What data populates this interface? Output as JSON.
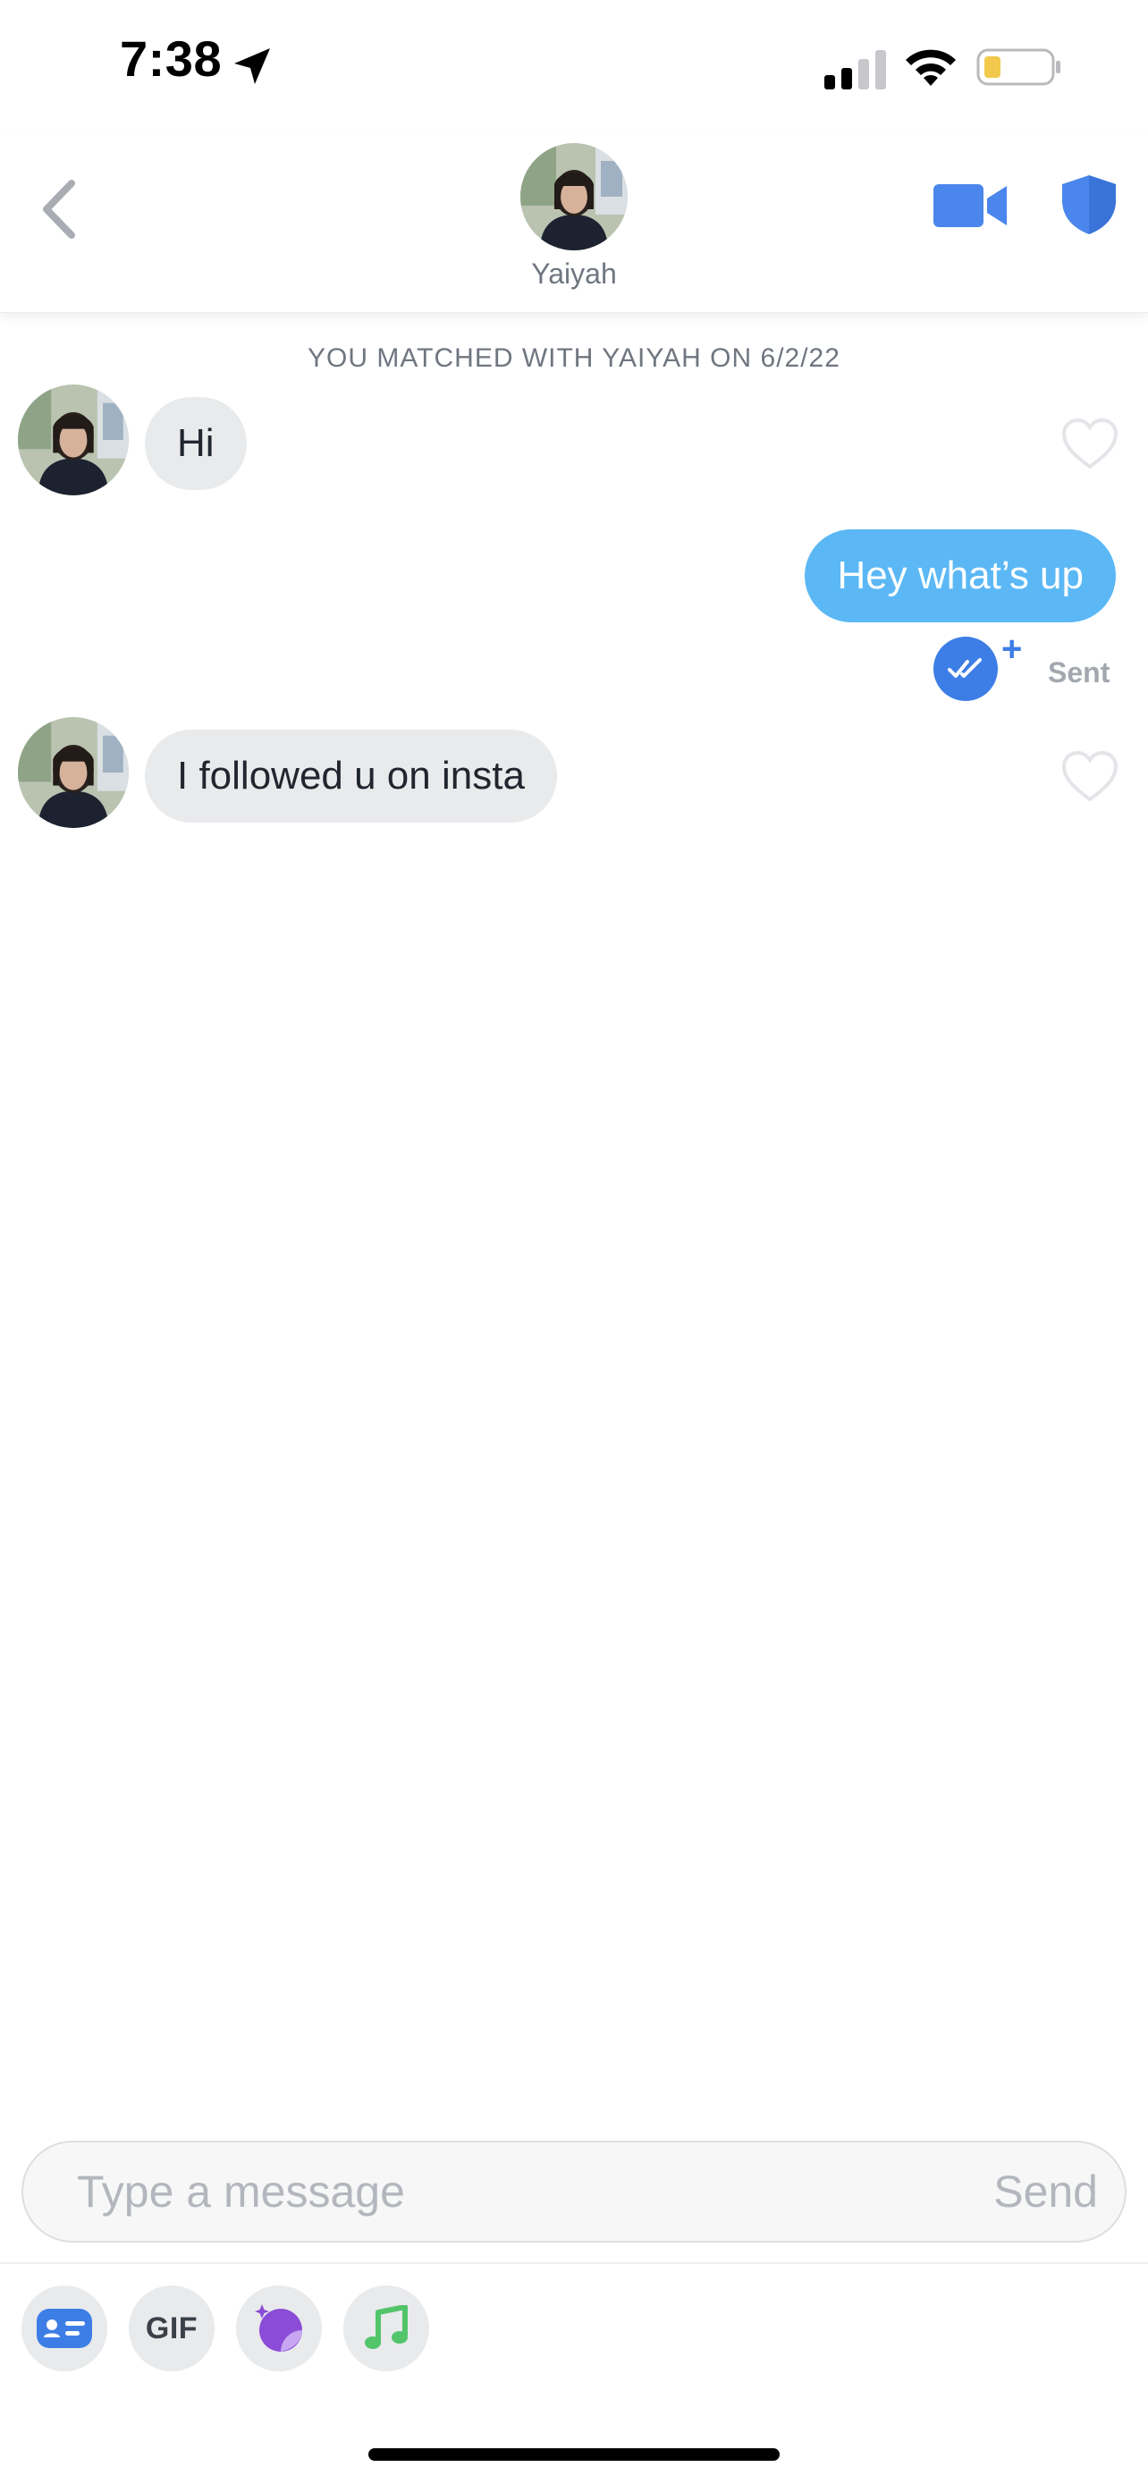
{
  "status_bar": {
    "time": "7:38",
    "icons": [
      "location-arrow-icon",
      "cellular-signal-icon",
      "wifi-icon",
      "battery-low-icon"
    ]
  },
  "header": {
    "back_icon": "chevron-left-icon",
    "match_name": "Yaiyah",
    "video_icon": "video-camera-icon",
    "safety_icon": "shield-icon"
  },
  "chat": {
    "match_banner": "YOU MATCHED WITH YAIYAH ON 6/2/22",
    "messages": [
      {
        "direction": "received",
        "text": "Hi",
        "like_icon": "heart-outline-icon"
      },
      {
        "direction": "sent",
        "text": "Hey what’s up",
        "status": "Sent",
        "status_icon": "double-check-icon",
        "extra": "+"
      },
      {
        "direction": "received",
        "text": "I followed u on insta",
        "like_icon": "heart-outline-icon"
      }
    ]
  },
  "composer": {
    "placeholder": "Type a message",
    "value": "",
    "send_label": "Send"
  },
  "toolbar": {
    "items": [
      {
        "name": "contact-card-icon"
      },
      {
        "name": "gif-button",
        "label": "GIF"
      },
      {
        "name": "sticker-icon"
      },
      {
        "name": "music-note-icon"
      }
    ]
  },
  "colors": {
    "accent_blue": "#3d7ee6",
    "sent_bubble": "#5bb8f5",
    "received_bubble": "#e9eaec",
    "music_green": "#52c46a",
    "sticker_purple": "#8b4dd8"
  }
}
